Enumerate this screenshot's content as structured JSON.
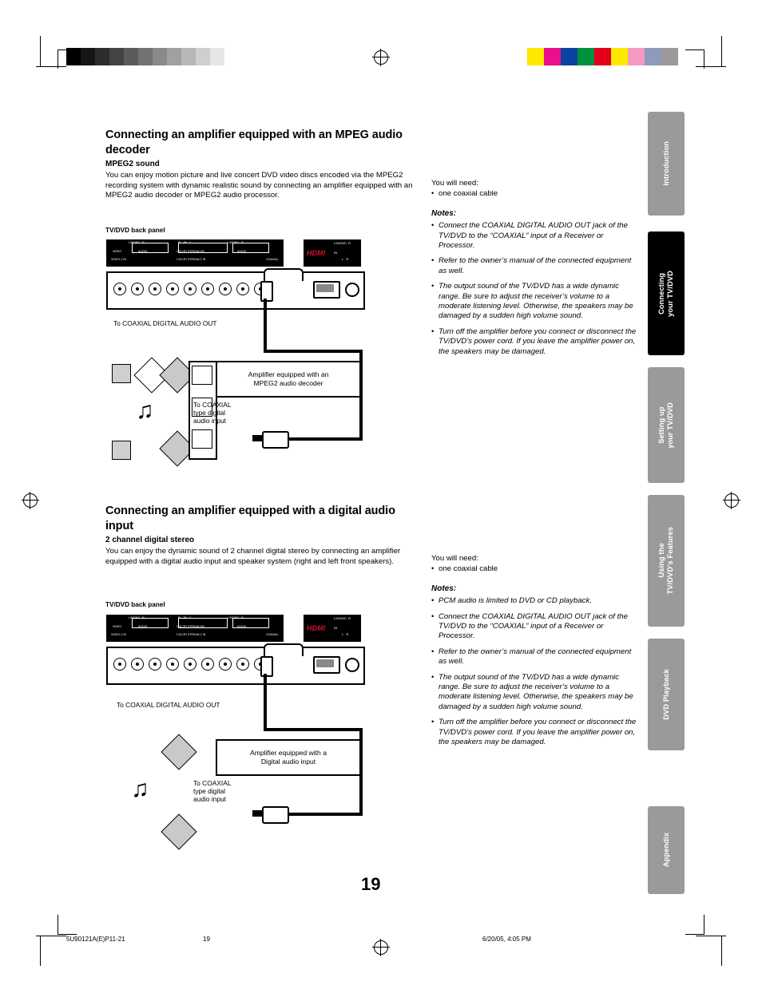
{
  "page": {
    "number": "19",
    "footer_left": "5U90121A(E)P11-21",
    "footer_center": "19",
    "footer_right": "6/20/05, 4:05 PM"
  },
  "side_tabs": [
    {
      "label": "Introduction",
      "active": false
    },
    {
      "label": "Connecting\nyour TV/DVD",
      "active": true
    },
    {
      "label": "Setting up\nyour TV/DVD",
      "active": false
    },
    {
      "label": "Using the\nTV/DVD's Features",
      "active": false
    },
    {
      "label": "DVD Playback",
      "active": false
    },
    {
      "label": "Appendix",
      "active": false
    }
  ],
  "colors": {
    "tab_active": "#000000",
    "tab_inactive": "#9a9a9a",
    "tab_text": "#ffffff",
    "hdmi_red": "#d0102a",
    "swatches": [
      "#ffe800",
      "#ec0f8c",
      "#0b43a0",
      "#00913f",
      "#e2001a",
      "#ffe800",
      "#f49ac1",
      "#8e9bbd",
      "#9a9a9a"
    ],
    "gray_ramp": [
      "#000000",
      "#161616",
      "#2d2d2d",
      "#444444",
      "#5b5b5b",
      "#727272",
      "#8a8a8a",
      "#a1a1a1",
      "#b8b8b8",
      "#cfcfcf",
      "#e6e6e6",
      "#ffffff"
    ]
  },
  "sections": [
    {
      "id": "mpeg2",
      "heading": "Connecting an amplifier equipped with an MPEG audio decoder",
      "subheading": "MPEG2 sound",
      "body": "You can enjoy motion picture and live concert DVD video discs encoded via the MPEG2 recording system with dynamic realistic sound by connecting an amplifier equipped with an MPEG2 audio decoder or MPEG2 audio processor.",
      "panel_caption": "TV/DVD back panel",
      "jack_label": "To COAXIAL DIGITAL AUDIO OUT",
      "amp_box": "Amplifier equipped with an\nMPEG2 audio decoder",
      "amp_input_label": "To COAXIAL\ntype digital\naudio input",
      "need_title": "You will need:",
      "need_items": [
        "one coaxial cable"
      ],
      "notes_title": "Notes:",
      "notes": [
        "Connect the COAXIAL DIGITAL AUDIO OUT jack of the TV/DVD to the “COAXIAL” input of a Receiver or Processor.",
        "Refer to the owner’s manual of the connected equipment as well.",
        "The output sound of the TV/DVD has a wide dynamic range. Be sure to adjust the receiver’s volume to a moderate listening level. Otherwise, the speakers may be damaged by a sudden high volume sound.",
        "Turn off the amplifier before you connect or disconnect the TV/DVD’s power cord. If you leave the amplifier power on, the speakers may be damaged."
      ]
    },
    {
      "id": "digital",
      "heading": "Connecting an amplifier equipped with a digital audio input",
      "subheading": "2 channel digital stereo",
      "body": "You can enjoy the dynamic sound of 2 channel digital stereo by connecting an amplifier equipped with a digital audio input and speaker system (right and left front speakers).",
      "panel_caption": "TV/DVD back panel",
      "jack_label": "To COAXIAL DIGITAL AUDIO OUT",
      "amp_box": "Amplifier equipped with a\nDigital audio input",
      "amp_input_label": "To COAXIAL\ntype digital\naudio input",
      "need_title": "You will need:",
      "need_items": [
        "one coaxial cable"
      ],
      "notes_title": "Notes:",
      "notes": [
        "PCM audio is limited to DVD or CD playback.",
        "Connect the COAXIAL DIGITAL AUDIO OUT jack of the TV/DVD to the “COAXIAL” input of a Receiver or Processor.",
        "Refer to the owner’s manual of the connected equipment as well.",
        "The output sound of the TV/DVD has a wide dynamic range. Be sure to adjust the receiver’s volume to a moderate listening level. Otherwise, the speakers may be damaged by a sudden high volume sound.",
        "Turn off the amplifier before you connect or disconnect the TV/DVD’s power cord. If you leave the amplifier power on, the speakers may be damaged."
      ]
    }
  ],
  "panel_labels": {
    "top_left": [
      "L/MONO",
      "R",
      "Pr",
      "Pb",
      "Y",
      "L/MONO",
      "R"
    ],
    "row2": [
      "VIDEO",
      "AUDIO",
      "COLOR STREAM HD",
      "AUDIO"
    ],
    "row3": [
      "VIDEO-1 IN",
      "COLOR STREAM 2 IN"
    ],
    "coaxial": "COAXIAL",
    "hdmi": "HDMI",
    "hdmi_in": "IN",
    "hdmi_audio": [
      "L/MONO",
      "R",
      "L",
      "R"
    ]
  }
}
